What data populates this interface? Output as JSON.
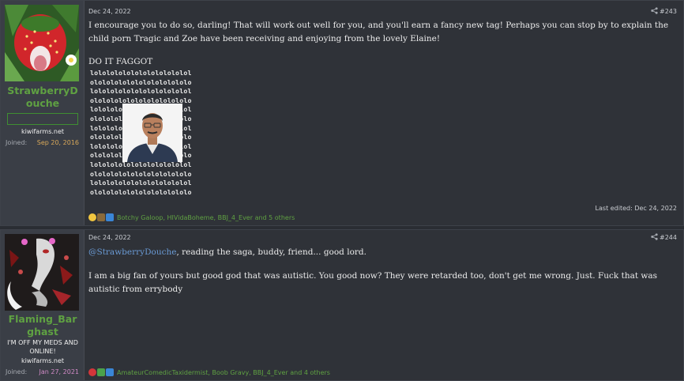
{
  "posts": [
    {
      "author": "StrawberryDouche",
      "user_title": "",
      "site": "kiwifarms.net",
      "joined_label": "Joined:",
      "joined_date": "Sep 20, 2016",
      "date": "Dec 24, 2022",
      "post_number": "#243",
      "body_paragraph": "I encourage you to do so, darling! That will work out well for you, and you'll earn a fancy new tag! Perhaps you can stop by to explain the child porn Tragic and Zoe have been receiving and enjoying from the lovely Elaine!",
      "body_line2": "DO IT FAGGOT",
      "lol_lines": [
        "lolololololololololololol",
        "ololololololololololololo",
        "lolololololololololololol",
        "ololololololololololololo",
        "lolololololololololololol",
        "ololololololololololololo",
        "lolololololololololololol",
        "ololololololololololololo",
        "lolololololololololololol",
        "ololololololololololololo",
        "lolololololololololololol",
        "ololololololololololololo",
        "lolololololololololololol",
        "ololololololololololololo"
      ],
      "last_edited": "Last edited: Dec 24, 2022",
      "reactions_text": "Botchy Galoop, HIVidaBoheme, BBJ_4_Ever and 5 others"
    },
    {
      "author": "Flaming_Barghast",
      "user_title": "I'M OFF MY MEDS AND ONLINE!",
      "site": "kiwifarms.net",
      "joined_label": "Joined:",
      "joined_date": "Jan 27, 2021",
      "date": "Dec 24, 2022",
      "post_number": "#244",
      "mention": "@StrawberryDouche",
      "mention_rest": ", reading the saga, buddy, friend... good lord.",
      "body_paragraph2": "I am a big fan of yours but good god that was autistic. You good now? They were retarded too, don't get me wrong. Just. Fuck that was autistic from errybody",
      "reactions_text": "AmateurComedicTaxidermist, Boob Gravy, BBJ_4_Ever and 4 others"
    }
  ],
  "icons": {
    "share": "share-icon",
    "reaction_1": "laugh-icon",
    "reaction_2": "informative-icon"
  },
  "colors": {
    "username": "#5fa142",
    "mention": "#6a9ad4",
    "joined_date_1": "#d8a85a",
    "joined_date_2": "#d08ac6"
  }
}
